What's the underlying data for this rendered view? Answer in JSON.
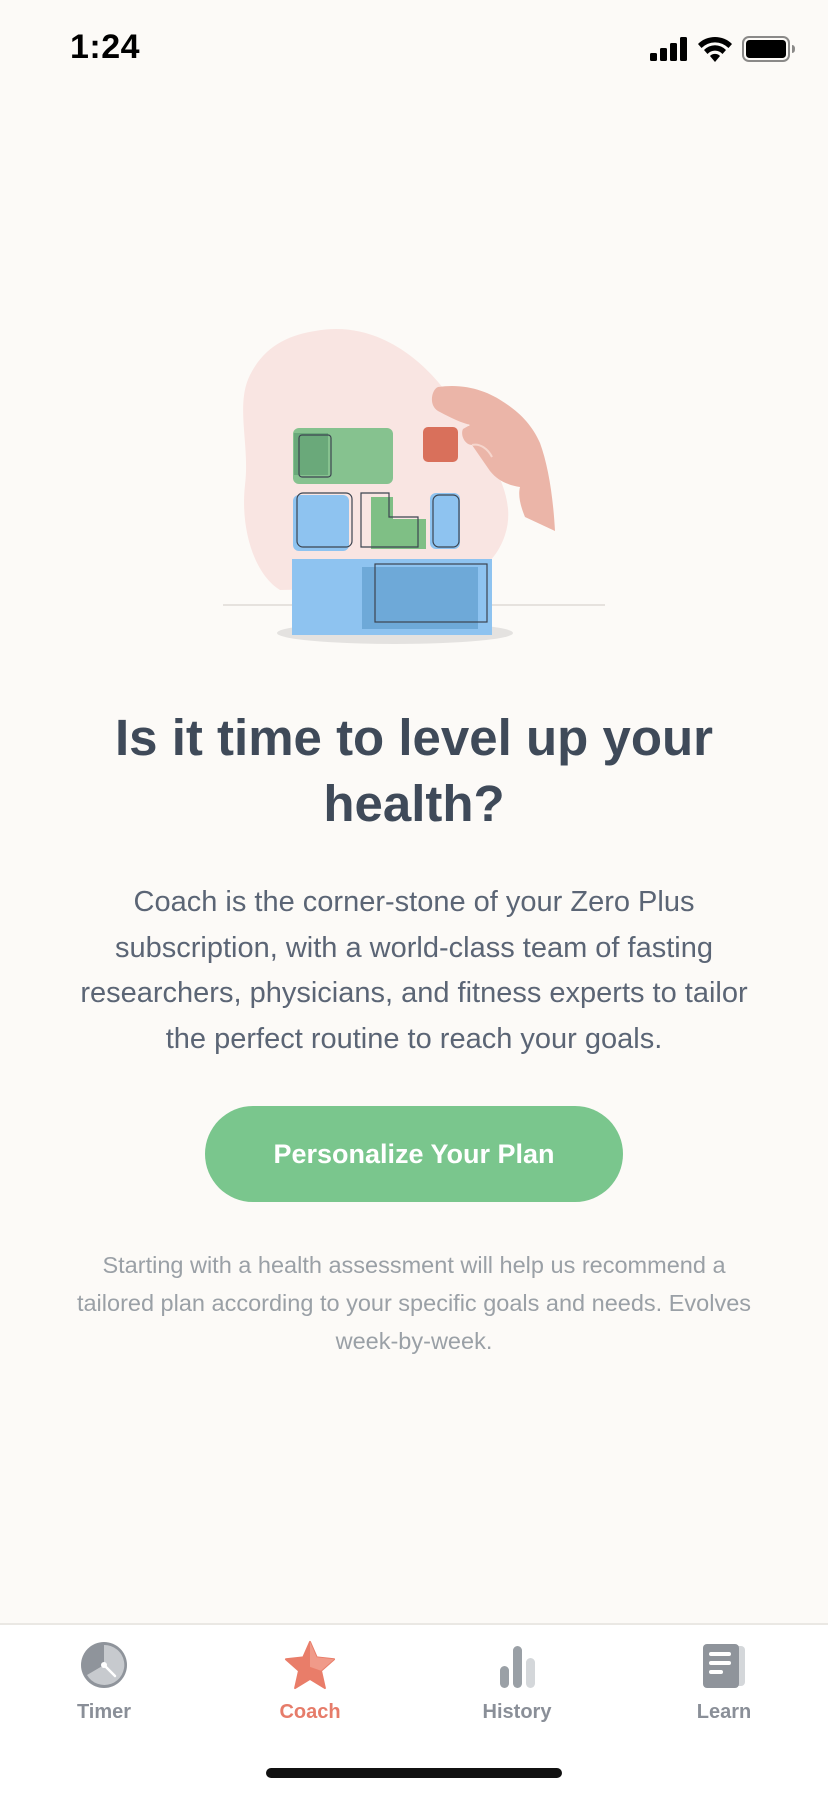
{
  "status_bar": {
    "time": "1:24"
  },
  "main": {
    "headline": "Is it time to level up your health?",
    "description": "Coach is the corner-stone of your Zero Plus subscription, with a world-class team of fasting researchers, physicians, and fitness experts to tailor the perfect routine to reach your goals.",
    "cta_label": "Personalize Your Plan",
    "footnote": "Starting with a health assessment will help us recommend a tailored plan according to your specific goals and needs. Evolves week-by-week."
  },
  "tab_bar": {
    "tabs": [
      {
        "label": "Timer",
        "icon": "timer-icon",
        "active": false
      },
      {
        "label": "Coach",
        "icon": "star-icon",
        "active": true
      },
      {
        "label": "History",
        "icon": "bar-chart-icon",
        "active": false
      },
      {
        "label": "Learn",
        "icon": "article-icon",
        "active": false
      }
    ]
  },
  "colors": {
    "background": "#fcfaf7",
    "primary_button": "#7ac68d",
    "active_tab": "#e67c6a",
    "inactive_tab": "#8a8f98",
    "heading": "#3f4a59"
  }
}
